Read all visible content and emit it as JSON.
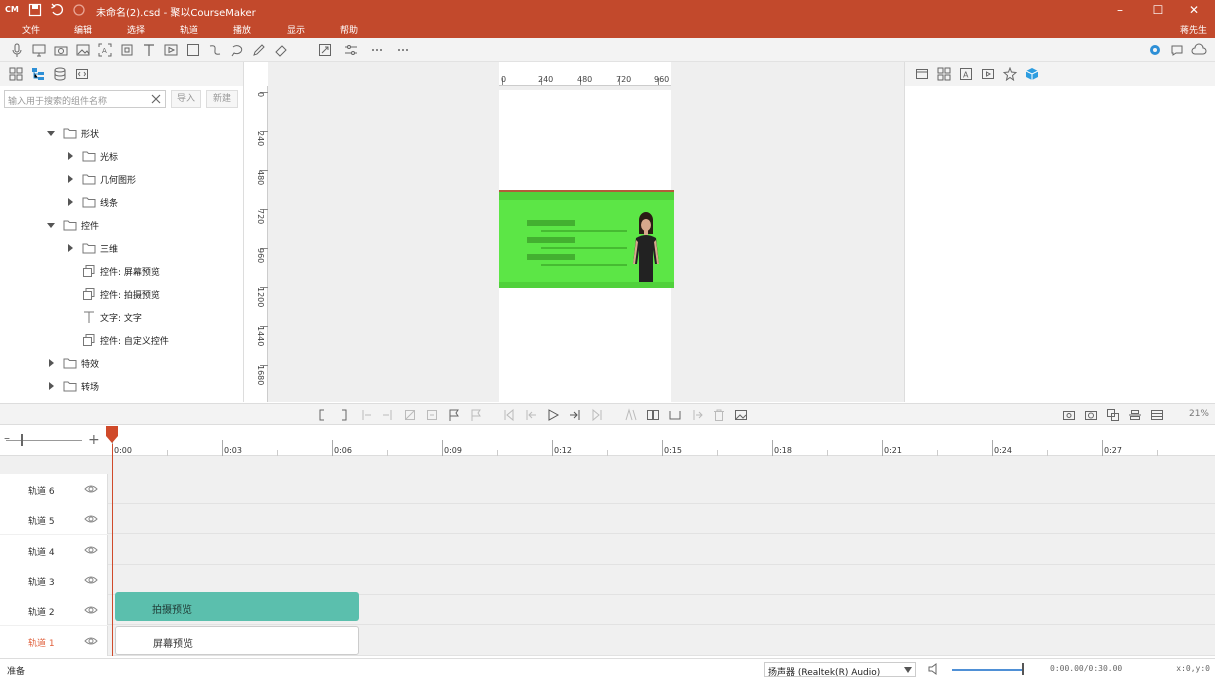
{
  "window": {
    "logo": "CM",
    "title": "未命名(2).csd - 聚以CourseMaker",
    "controls": [
      "–",
      "☐",
      "✕"
    ]
  },
  "menu": [
    "文件",
    "编辑",
    "选择",
    "轨道",
    "播放",
    "显示",
    "帮助"
  ],
  "user": "蒋先生",
  "left_panel": {
    "search_placeholder": "输入用于搜索的组件名称",
    "import_label": "导入",
    "new_label": "新建",
    "tree": [
      {
        "label": "形状",
        "level": 1,
        "expanded": true,
        "type": "folder"
      },
      {
        "label": "光标",
        "level": 2,
        "expanded": false,
        "type": "folder"
      },
      {
        "label": "几何图形",
        "level": 2,
        "expanded": false,
        "type": "folder"
      },
      {
        "label": "线条",
        "level": 2,
        "expanded": false,
        "type": "folder"
      },
      {
        "label": "控件",
        "level": 1,
        "expanded": true,
        "type": "folder"
      },
      {
        "label": "三维",
        "level": 2,
        "expanded": false,
        "type": "folder"
      },
      {
        "label": "控件: 屏幕预览",
        "level": 2,
        "type": "widget"
      },
      {
        "label": "控件: 拍摄预览",
        "level": 2,
        "type": "widget"
      },
      {
        "label": "文字: 文字",
        "level": 2,
        "type": "text"
      },
      {
        "label": "控件: 自定义控件",
        "level": 2,
        "type": "widget"
      },
      {
        "label": "特效",
        "level": 1,
        "expanded": false,
        "type": "folder"
      },
      {
        "label": "转场",
        "level": 1,
        "expanded": false,
        "type": "folder"
      }
    ]
  },
  "rulers": {
    "horizontal": [
      "0",
      "240",
      "480",
      "720",
      "960"
    ],
    "vertical": [
      "0",
      "240",
      "480",
      "720",
      "960",
      "1200",
      "1440",
      "1680"
    ]
  },
  "timeline": {
    "zoom_percent": "21%",
    "time_labels": [
      "0:00",
      "0:03",
      "0:06",
      "0:09",
      "0:12",
      "0:15",
      "0:18",
      "0:21",
      "0:24",
      "0:27"
    ],
    "tracks": [
      {
        "label": "轨道 6",
        "active": false
      },
      {
        "label": "轨道 5",
        "active": false
      },
      {
        "label": "轨道 4",
        "active": false
      },
      {
        "label": "轨道 3",
        "active": false
      },
      {
        "label": "轨道 2",
        "active": false
      },
      {
        "label": "轨道 1",
        "active": true
      }
    ],
    "clips": {
      "camera": "拍摄预览",
      "screen": "屏幕预览"
    }
  },
  "status": {
    "text": "准备",
    "audio_device": "扬声器 (Realtek(R) Audio)",
    "time_readout": "0:00.00/0:30.00",
    "coords": "x:0,y:0",
    "volume_level": 0.97
  },
  "colors": {
    "title_bar": "#c2492c",
    "clip_camera": "#5bbfad",
    "slide_green": "#5ce646",
    "active_track": "#e0603c"
  }
}
